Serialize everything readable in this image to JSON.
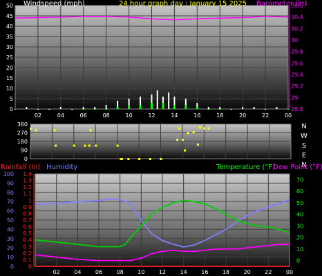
{
  "title": "24 hour graph day : January 15 2025",
  "x_hour_labels": [
    "02",
    "04",
    "06",
    "08",
    "10",
    "12",
    "14",
    "16",
    "18",
    "20",
    "22",
    "00"
  ],
  "colors": {
    "wind": "#ffffff",
    "gust": "#00ff00",
    "barometer": "#ff00ff",
    "direction": "#ffff00",
    "rainfall": "#ff2020",
    "humidity": "#8080ff",
    "temperature": "#00d000",
    "dewpoint": "#ff00ff",
    "label": "#ffffff",
    "background": "#000000"
  },
  "panels": [
    {
      "id": "wind-baro",
      "left_label": "Windspeed (mph)",
      "right_label": "Barometer (in)",
      "left_ticks": [
        "0",
        "5",
        "10",
        "15",
        "20",
        "25",
        "30",
        "35",
        "40",
        "45",
        "50"
      ],
      "right_ticks": [
        "28.8",
        "29",
        "29.2",
        "29.4",
        "29.6",
        "29.8",
        "30",
        "30.2",
        "30.4",
        "30.6"
      ]
    },
    {
      "id": "direction",
      "left_ticks": [
        "0",
        "90",
        "180",
        "270",
        "360"
      ],
      "right_ticks": [
        "N",
        "W",
        "S",
        "E",
        "N"
      ]
    },
    {
      "id": "rain-hum-temp",
      "left_label_1": "Rainfall (in)",
      "left_label_2": "Humidity",
      "right_label_1": "Temperature (°F)",
      "right_label_2": "Dew Point (°F)",
      "humidity_ticks": [
        "0",
        "10",
        "20",
        "30",
        "40",
        "50",
        "60",
        "70",
        "80",
        "90",
        "100"
      ],
      "rain_ticks": [
        "0",
        "0.1",
        "0.2",
        "0.3",
        "0.4",
        "0.5",
        "0.6",
        "0.7",
        "0.8",
        "0.9",
        "1",
        "1.1",
        "1.2",
        "1.3",
        "1.4"
      ],
      "temp_ticks": [
        "0",
        "10",
        "20",
        "30",
        "40",
        "50",
        "60",
        "70"
      ]
    }
  ],
  "chart_data": [
    {
      "type": "line",
      "title": "24 hour graph day : January 15 2025",
      "xlabel": "hour",
      "ylabel": "Windspeed (mph)",
      "y2label": "Barometer (in)",
      "ylim": [
        0,
        50
      ],
      "y2lim": [
        28.8,
        30.6
      ],
      "series": [
        {
          "name": "Barometer (in)",
          "axis": "right",
          "x": [
            0,
            2,
            4,
            6,
            8,
            10,
            12,
            13,
            14,
            15,
            16,
            18,
            20,
            22,
            24
          ],
          "values": [
            30.38,
            30.39,
            30.4,
            30.41,
            30.41,
            30.4,
            30.37,
            30.36,
            30.35,
            30.36,
            30.37,
            30.38,
            30.39,
            30.41,
            30.4
          ]
        },
        {
          "name": "Windspeed (mph)",
          "axis": "left",
          "x": [
            0,
            1,
            2,
            3,
            4,
            5,
            6,
            7,
            8,
            9,
            10,
            11,
            12,
            12.5,
            13,
            13.5,
            14,
            15,
            16,
            17,
            18,
            19,
            20,
            21,
            22,
            23,
            24
          ],
          "values": [
            0,
            1,
            0,
            0,
            1,
            0,
            1,
            1,
            2,
            4,
            5,
            6,
            7,
            9,
            6,
            8,
            6,
            5,
            3,
            1,
            1,
            0,
            1,
            1,
            0,
            1,
            0
          ]
        },
        {
          "name": "Gust (mph)",
          "axis": "left",
          "x": [
            0,
            6,
            7,
            8,
            9,
            10,
            11,
            12,
            13,
            14,
            15,
            16,
            17,
            18,
            24
          ],
          "values": [
            0,
            0,
            0,
            0,
            1,
            2,
            2,
            3,
            3,
            2,
            2,
            1,
            0,
            0,
            0
          ]
        }
      ]
    },
    {
      "type": "scatter",
      "ylabel": "Wind direction",
      "ylim": [
        0,
        360
      ],
      "series": [
        {
          "name": "Wind direction",
          "x": [
            0,
            0.5,
            2.2,
            2.3,
            4,
            5,
            5.4,
            5.5,
            6,
            8,
            8.3,
            8.4,
            9,
            10,
            11,
            12,
            13.5,
            13.7,
            14,
            14.2,
            14.5,
            15,
            15.4,
            15.6,
            16,
            16.4
          ],
          "values": [
            315,
            300,
            300,
            140,
            140,
            140,
            140,
            300,
            140,
            140,
            0,
            0,
            0,
            0,
            0,
            0,
            200,
            320,
            200,
            90,
            270,
            280,
            150,
            330,
            320,
            320
          ]
        }
      ]
    },
    {
      "type": "line",
      "xlabel": "hour",
      "ylabel": "Humidity / Rainfall (in)",
      "y2label": "Temperature (°F) / Dew Point (°F)",
      "ylim": [
        0,
        100
      ],
      "y2lim": [
        -5,
        75
      ],
      "series": [
        {
          "name": "Humidity",
          "axis": "left",
          "x": [
            0,
            2,
            4,
            6,
            7,
            8,
            9,
            10,
            11,
            12,
            13,
            14,
            15,
            16,
            17,
            18,
            19,
            20,
            21,
            22,
            23,
            24
          ],
          "values": [
            67,
            68,
            70,
            71,
            73,
            72,
            68,
            50,
            35,
            28,
            24,
            21,
            23,
            28,
            34,
            40,
            48,
            55,
            60,
            64,
            68,
            72
          ]
        },
        {
          "name": "Rainfall (in)",
          "axis": "left",
          "x": [
            0,
            24
          ],
          "values": [
            0,
            0
          ]
        },
        {
          "name": "Temperature (°F)",
          "axis": "right",
          "x": [
            0,
            2,
            4,
            6,
            7,
            8,
            8.5,
            9,
            10,
            11,
            12,
            13,
            14,
            15,
            16,
            17,
            18,
            19,
            20,
            21,
            22,
            23,
            24
          ],
          "values": [
            18,
            16,
            14,
            12,
            12,
            12,
            14,
            20,
            30,
            40,
            46,
            50,
            52,
            51,
            49,
            45,
            40,
            35,
            32,
            30,
            29,
            27,
            24
          ]
        },
        {
          "name": "Dew Point (°F)",
          "axis": "right",
          "x": [
            0,
            2,
            4,
            6,
            7,
            8,
            9,
            10,
            11,
            12,
            13,
            14,
            15,
            16,
            17,
            18,
            19,
            20,
            21,
            22,
            23,
            24
          ],
          "values": [
            5,
            3,
            1,
            0,
            0,
            0,
            0,
            2,
            6,
            8,
            9,
            8,
            8,
            9,
            10,
            10,
            10,
            11,
            12,
            13,
            14,
            14
          ]
        }
      ]
    }
  ]
}
